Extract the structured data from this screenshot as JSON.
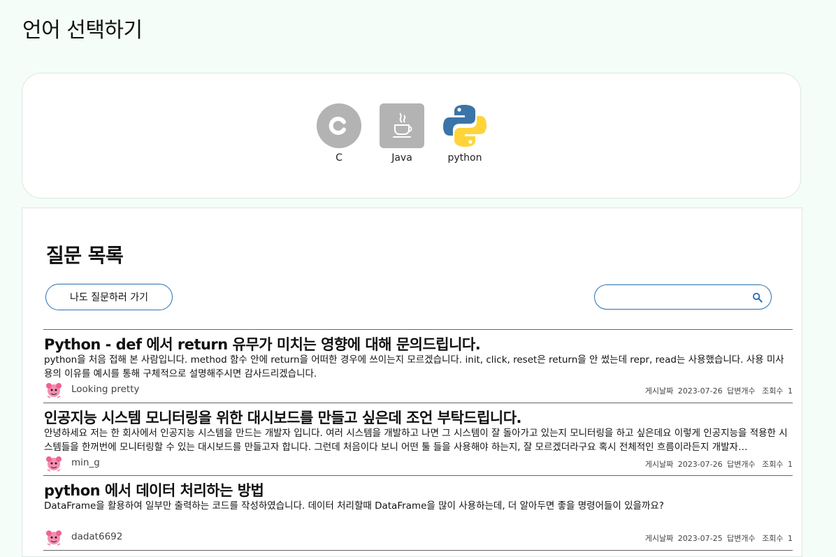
{
  "page_title": "언어 선택하기",
  "languages": [
    {
      "label": "C",
      "icon": "c-language-icon"
    },
    {
      "label": "Java",
      "icon": "java-icon"
    },
    {
      "label": "python",
      "icon": "python-icon"
    }
  ],
  "questions": {
    "title": "질문 목록",
    "ask_button": "나도 질문하러 가기",
    "search": {
      "placeholder": "",
      "value": ""
    },
    "posts": [
      {
        "title": "Python - def 에서 return 유무가 미치는 영향에 대해 문의드립니다.",
        "body": "python을 처음 접해 본 사람입니다. method 함수 안에 return을 어떠한 경우에 쓰이는지 모르겠습니다. init, click, reset은 return을 안 썼는데 repr, read는 사용했습니다. 사용 미사용의 이유를 예시를 통해 구체적으로 설명해주시면 감사드리겠습니다.",
        "author": "Looking pretty",
        "date_label": "게시날짜",
        "date": "2023-07-26",
        "answers_label": "답변개수",
        "answers": "",
        "views_label": "조회수",
        "views": "1"
      },
      {
        "title": "인공지능 시스템 모니터링을 위한 대시보드를 만들고 싶은데 조언 부탁드립니다.",
        "body": "안녕하세요 저는 한 회사에서 인공지능 시스템을 만드는 개발자 입니다. 여러 시스템을 개발하고 나면 그 시스템이 잘 돌아가고 있는지 모니터링을 하고 싶은데요 이렇게 인공지능을 적용한 시스템들을 한꺼번에 모니터링할 수 있는 대시보드를 만들고자 합니다. 그런데 처음이다 보니 어떤 툴 들을 사용해야 하는지, 잘 모르겠더라구요 혹시 전체적인 흐름이라든지 개발자…",
        "author": "min_g",
        "date_label": "게시날짜",
        "date": "2023-07-26",
        "answers_label": "답변개수",
        "answers": "",
        "views_label": "조회수",
        "views": "1"
      },
      {
        "title": "python 에서 데이터 처리하는 방법",
        "body": "DataFrame을 활용하여 일부만 출력하는 코드를 작성하였습니다.  데이터 처리할때 DataFrame을 많이 사용하는데, 더 알아두면 좋을 명령어들이 있을까요?",
        "author": "dadat6692",
        "date_label": "게시날짜",
        "date": "2023-07-25",
        "answers_label": "답변개수",
        "answers": "",
        "views_label": "조회수",
        "views": "1"
      }
    ]
  },
  "colors": {
    "background": "#f5fdf8",
    "accent": "#2a6fb0",
    "icon_gray": "#b3b3b3"
  }
}
